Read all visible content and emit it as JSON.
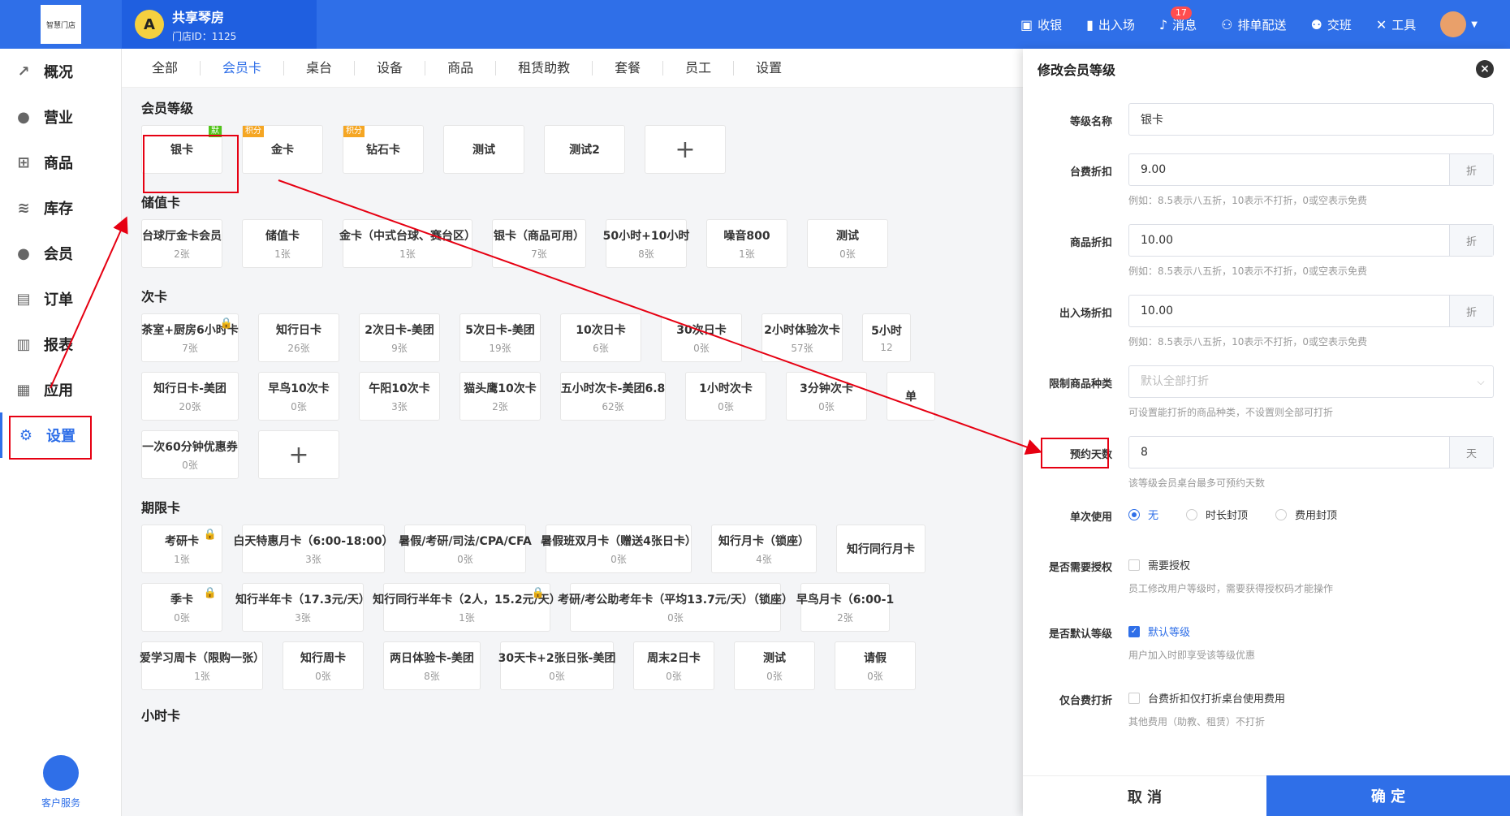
{
  "logo": {
    "text": "智慧门店"
  },
  "store": {
    "avatar_letter": "A",
    "name": "共享琴房",
    "id_text": "门店ID：1125"
  },
  "top_actions": [
    {
      "label": "收银",
      "icon": "cashier-icon"
    },
    {
      "label": "出入场",
      "icon": "door-icon"
    },
    {
      "label": "消息",
      "icon": "bell-icon",
      "badge": "17"
    },
    {
      "label": "排单配送",
      "icon": "delivery-icon"
    },
    {
      "label": "交班",
      "icon": "handover-icon"
    },
    {
      "label": "工具",
      "icon": "tools-icon"
    }
  ],
  "sidebar": {
    "items": [
      {
        "label": "概况",
        "icon": "chart-icon"
      },
      {
        "label": "营业",
        "icon": "money-bag-icon"
      },
      {
        "label": "商品",
        "icon": "cart-icon"
      },
      {
        "label": "库存",
        "icon": "layers-icon"
      },
      {
        "label": "会员",
        "icon": "user-icon"
      },
      {
        "label": "订单",
        "icon": "order-icon"
      },
      {
        "label": "报表",
        "icon": "report-icon"
      },
      {
        "label": "应用",
        "icon": "apps-icon"
      },
      {
        "label": "设置",
        "icon": "gear-icon"
      }
    ],
    "service_label": "客户服务"
  },
  "tabs": [
    "全部",
    "会员卡",
    "桌台",
    "设备",
    "商品",
    "租赁助教",
    "套餐",
    "员工",
    "设置"
  ],
  "sections": {
    "member_level": {
      "title": "会员等级",
      "cards": [
        {
          "name": "银卡",
          "tag_default": "默"
        },
        {
          "name": "金卡",
          "tag": "积分"
        },
        {
          "name": "钻石卡",
          "tag": "积分"
        },
        {
          "name": "测试"
        },
        {
          "name": "测试2"
        }
      ],
      "add": "+"
    },
    "stored_value": {
      "title": "储值卡",
      "cards": [
        {
          "name": "台球厅金卡会员",
          "sub": "2张"
        },
        {
          "name": "储值卡",
          "sub": "1张"
        },
        {
          "name": "金卡（中式台球、赛台区）",
          "sub": "1张"
        },
        {
          "name": "银卡（商品可用）",
          "sub": "7张"
        },
        {
          "name": "50小时+10小时",
          "sub": "8张"
        },
        {
          "name": "噪音800",
          "sub": "1张"
        },
        {
          "name": "测试",
          "sub": "0张"
        }
      ]
    },
    "count_card": {
      "title": "次卡",
      "row1": [
        {
          "name": "茶室+厨房6小时卡",
          "sub": "7张",
          "lock": true
        },
        {
          "name": "知行日卡",
          "sub": "26张"
        },
        {
          "name": "2次日卡-美团",
          "sub": "9张"
        },
        {
          "name": "5次日卡-美团",
          "sub": "19张"
        },
        {
          "name": "10次日卡",
          "sub": "6张"
        },
        {
          "name": "30次日卡",
          "sub": "0张"
        },
        {
          "name": "2小时体验次卡",
          "sub": "57张"
        },
        {
          "name": "5小时",
          "sub": "12"
        }
      ],
      "row2": [
        {
          "name": "知行日卡-美团",
          "sub": "20张"
        },
        {
          "name": "早鸟10次卡",
          "sub": "0张"
        },
        {
          "name": "午阳10次卡",
          "sub": "3张"
        },
        {
          "name": "猫头鹰10次卡",
          "sub": "2张"
        },
        {
          "name": "五小时次卡-美团6.8",
          "sub": "62张"
        },
        {
          "name": "1小时次卡",
          "sub": "0张"
        },
        {
          "name": "3分钟次卡",
          "sub": "0张"
        },
        {
          "name": "单",
          "sub": ""
        }
      ],
      "row3": [
        {
          "name": "一次60分钟优惠券",
          "sub": "0张"
        }
      ],
      "add": "+"
    },
    "period_card": {
      "title": "期限卡",
      "row1": [
        {
          "name": "考研卡",
          "sub": "1张",
          "lock": true
        },
        {
          "name": "白天特惠月卡（6:00-18:00）",
          "sub": "3张"
        },
        {
          "name": "暑假/考研/司法/CPA/CFA",
          "sub": "0张"
        },
        {
          "name": "暑假班双月卡（赠送4张日卡）",
          "sub": "0张"
        },
        {
          "name": "知行月卡（锁座）",
          "sub": "4张"
        },
        {
          "name": "知行同行月卡",
          "sub": ""
        }
      ],
      "row2": [
        {
          "name": "季卡",
          "sub": "0张",
          "lock": true
        },
        {
          "name": "知行半年卡（17.3元/天）",
          "sub": "3张"
        },
        {
          "name": "知行同行半年卡（2人，15.2元/天）",
          "sub": "1张",
          "lock": true
        },
        {
          "name": "考研/考公助考年卡（平均13.7元/天）（锁座）",
          "sub": "0张"
        },
        {
          "name": "早鸟月卡（6:00-1",
          "sub": "2张"
        }
      ],
      "row3": [
        {
          "name": "爱学习周卡（限购一张）",
          "sub": "1张"
        },
        {
          "name": "知行周卡",
          "sub": "0张"
        },
        {
          "name": "两日体验卡-美团",
          "sub": "8张"
        },
        {
          "name": "30天卡+2张日张-美团",
          "sub": "0张"
        },
        {
          "name": "周末2日卡",
          "sub": "0张"
        },
        {
          "name": "测试",
          "sub": "0张"
        },
        {
          "name": "请假",
          "sub": "0张"
        }
      ]
    },
    "hour_card": {
      "title": "小时卡"
    }
  },
  "panel": {
    "title": "修改会员等级",
    "close": "×",
    "fields": {
      "level_name": {
        "label": "等级名称",
        "value": "银卡"
      },
      "table_discount": {
        "label": "台费折扣",
        "value": "9.00",
        "suffix": "折",
        "hint": "例如：8.5表示八五折，10表示不打折，0或空表示免费"
      },
      "goods_discount": {
        "label": "商品折扣",
        "value": "10.00",
        "suffix": "折",
        "hint": "例如：8.5表示八五折，10表示不打折，0或空表示免费"
      },
      "entry_discount": {
        "label": "出入场折扣",
        "value": "10.00",
        "suffix": "折",
        "hint": "例如：8.5表示八五折，10表示不打折，0或空表示免费"
      },
      "limit_goods": {
        "label": "限制商品种类",
        "placeholder": "默认全部打折",
        "hint": "可设置能打折的商品种类，不设置则全部可打折"
      },
      "reserve_days": {
        "label": "预约天数",
        "value": "8",
        "suffix": "天",
        "hint": "该等级会员桌台最多可预约天数"
      },
      "single_use": {
        "label": "单次使用",
        "options": [
          "无",
          "时长封顶",
          "费用封顶"
        ],
        "selected": "无"
      },
      "need_auth": {
        "label": "是否需要授权",
        "check_label": "需要授权",
        "hint": "员工修改用户等级时，需要获得授权码才能操作"
      },
      "is_default": {
        "label": "是否默认等级",
        "check_label": "默认等级",
        "hint": "用户加入时即享受该等级优惠"
      },
      "table_only": {
        "label": "仅台费打折",
        "check_label": "台费折扣仅打折桌台使用费用",
        "hint": "其他费用（助教、租赁）不打折"
      }
    },
    "cancel_label": "取 消",
    "ok_label": "确 定"
  },
  "colors": {
    "primary": "#2f6fe8",
    "annotation": "#e60012"
  }
}
